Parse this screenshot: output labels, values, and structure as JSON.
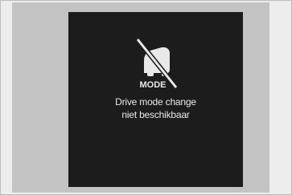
{
  "screen": {
    "icon": "drive-mode-disabled-icon",
    "icon_label": "MODE",
    "message_line1": "Drive mode change",
    "message_line2": "niet beschikbaar"
  },
  "colors": {
    "screen_background": "#1c1c1c",
    "text": "#e8e8e8",
    "panel_background": "#c3c3c3"
  }
}
